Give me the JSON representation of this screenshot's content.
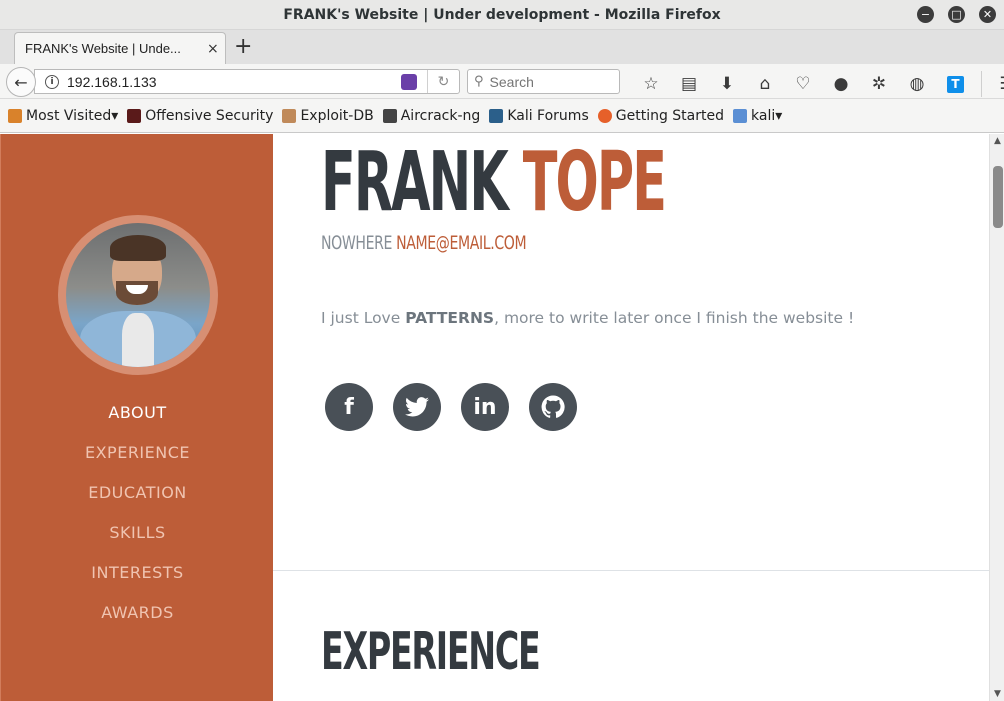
{
  "window": {
    "title": "FRANK's Website | Under development - Mozilla Firefox"
  },
  "tab": {
    "label": "FRANK's Website | Unde...",
    "close": "×",
    "new_tab": "+"
  },
  "navbar": {
    "url": "192.168.1.133",
    "search_placeholder": "Search"
  },
  "bookmarks": [
    {
      "label": "Most Visited",
      "icon": "folder-icon",
      "color": "#d9822b",
      "dropdown": true
    },
    {
      "label": "Offensive Security",
      "icon": "offsec-icon",
      "color": "#5a1a1a"
    },
    {
      "label": "Exploit-DB",
      "icon": "exploitdb-icon",
      "color": "#c08a5a"
    },
    {
      "label": "Aircrack-ng",
      "icon": "aircrack-icon",
      "color": "#444444"
    },
    {
      "label": "Kali Forums",
      "icon": "kali-icon",
      "color": "#2b5f8a"
    },
    {
      "label": "Getting Started",
      "icon": "firefox-icon",
      "color": "#e6602a"
    },
    {
      "label": "kali",
      "icon": "folder-icon",
      "color": "#5b8fd4",
      "dropdown": true
    }
  ],
  "page": {
    "first_name": "FRANK",
    "last_name": "TOPE",
    "location": "NOWHERE",
    "email": "NAME@EMAIL.COM",
    "lead_prefix": "I just Love ",
    "lead_bold": "PATTERNS",
    "lead_suffix": ", more to write later once I finish the website !",
    "section_title": "EXPERIENCE",
    "accent_color": "#bd5d38"
  },
  "sidenav": {
    "items": [
      {
        "label": "ABOUT",
        "active": true
      },
      {
        "label": "EXPERIENCE",
        "active": false
      },
      {
        "label": "EDUCATION",
        "active": false
      },
      {
        "label": "SKILLS",
        "active": false
      },
      {
        "label": "INTERESTS",
        "active": false
      },
      {
        "label": "AWARDS",
        "active": false
      }
    ]
  },
  "socials": [
    {
      "name": "facebook-icon",
      "glyph": "f"
    },
    {
      "name": "twitter-icon",
      "glyph": "🐦"
    },
    {
      "name": "linkedin-icon",
      "glyph": "in"
    },
    {
      "name": "github-icon",
      "glyph": "◉"
    }
  ]
}
